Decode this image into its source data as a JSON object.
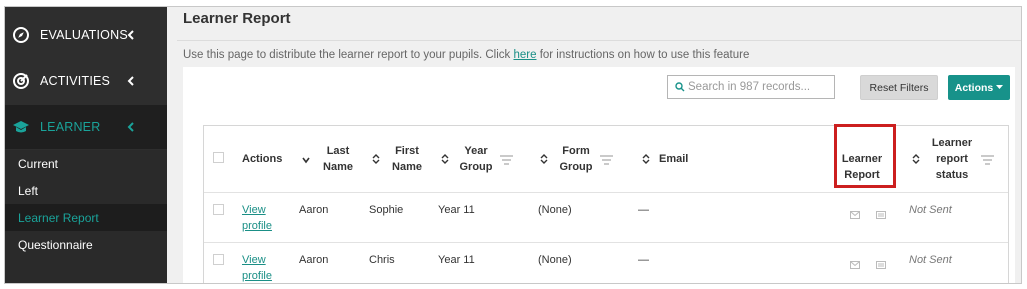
{
  "sidebar": {
    "items": [
      {
        "label": "EVALUATIONS",
        "icon": "compass-icon"
      },
      {
        "label": "ACTIVITIES",
        "icon": "activities-icon"
      },
      {
        "label": "LEARNER",
        "icon": "graduation-cap-icon"
      }
    ],
    "sub_items": [
      {
        "label": "Current"
      },
      {
        "label": "Left"
      },
      {
        "label": "Learner Report"
      },
      {
        "label": "Questionnaire"
      }
    ]
  },
  "page": {
    "title": "Learner Report",
    "intro_before": "Use this page to distribute the learner report to your pupils. Click ",
    "intro_link": "here",
    "intro_after": " for instructions on how to use this feature"
  },
  "toolbar": {
    "search_placeholder": "Search in 987 records...",
    "reset_label": "Reset Filters",
    "actions_label": "Actions"
  },
  "table": {
    "headers": {
      "actions": "Actions",
      "last_name": "Last Name",
      "first_name": "First Name",
      "year_group": "Year Group",
      "form_group": "Form Group",
      "email": "Email",
      "learner_report": "Learner Report",
      "learner_report_status": "Learner report status"
    },
    "rows": [
      {
        "action": "View profile",
        "last_name": "Aaron",
        "first_name": "Sophie",
        "year_group": "Year 11",
        "form_group": "(None)",
        "email": "—",
        "status": "Not Sent"
      },
      {
        "action": "View profile",
        "last_name": "Aaron",
        "first_name": "Chris",
        "year_group": "Year 11",
        "form_group": "(None)",
        "email": "—",
        "status": "Not Sent"
      }
    ]
  },
  "colors": {
    "accent": "#17928a",
    "sidebar_bg": "#2e2e2e",
    "highlight": "#cc1f1f"
  }
}
